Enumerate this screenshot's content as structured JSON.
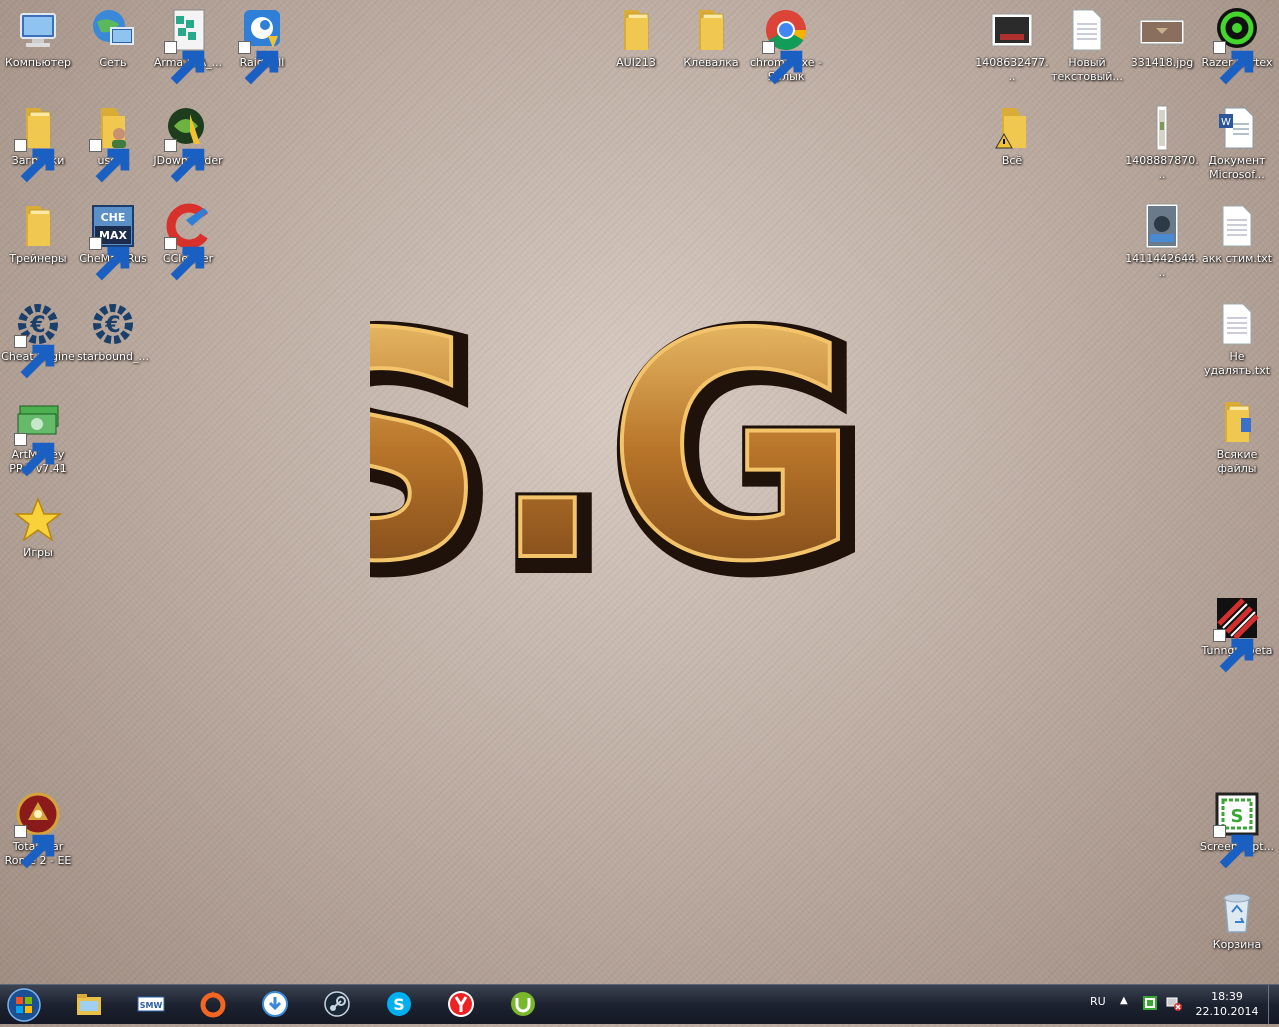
{
  "desktop": {
    "icons": [
      {
        "id": "computer",
        "label": "Компьютер",
        "icon": "computer-icon"
      },
      {
        "id": "network",
        "label": "Сеть",
        "icon": "network-icon"
      },
      {
        "id": "arma",
        "label": "Arma2OA_...",
        "icon": "arma-icon"
      },
      {
        "id": "raidcall",
        "label": "RaidCall",
        "icon": "raidcall-icon"
      },
      {
        "id": "aui",
        "label": "AUI213",
        "icon": "folder-icon"
      },
      {
        "id": "klevalka",
        "label": "Клевалка",
        "icon": "folder-icon"
      },
      {
        "id": "chrome",
        "label": "chrome.exe - Ярлык",
        "icon": "chrome-icon"
      },
      {
        "id": "img1408632",
        "label": "1408632477...",
        "icon": "image-icon"
      },
      {
        "id": "newtxt",
        "label": "Новый текстовый...",
        "icon": "text-file-icon"
      },
      {
        "id": "img331418",
        "label": "331418.jpg",
        "icon": "image-icon"
      },
      {
        "id": "razer",
        "label": "Razer Cortex",
        "icon": "razer-icon"
      },
      {
        "id": "downloads",
        "label": "Загрузки",
        "icon": "folder-icon"
      },
      {
        "id": "user1",
        "label": "user1",
        "icon": "user-folder-icon"
      },
      {
        "id": "jdownloader",
        "label": "JDownloader",
        "icon": "jdownloader-icon"
      },
      {
        "id": "vse",
        "label": "Всё",
        "icon": "folder-warning-icon"
      },
      {
        "id": "img1408887",
        "label": "1408887870...",
        "icon": "image-icon"
      },
      {
        "id": "docword",
        "label": "Документ Microsof...",
        "icon": "word-doc-icon"
      },
      {
        "id": "trainers",
        "label": "Трейнеры",
        "icon": "folder-icon"
      },
      {
        "id": "chemax",
        "label": "CheMax Rus",
        "icon": "chemax-icon"
      },
      {
        "id": "ccleaner",
        "label": "CCleaner",
        "icon": "ccleaner-icon"
      },
      {
        "id": "img1411442",
        "label": "1411442644...",
        "icon": "image-icon"
      },
      {
        "id": "akksteam",
        "label": "акк стим.txt",
        "icon": "text-file-icon"
      },
      {
        "id": "cheatengine",
        "label": "Cheat Engine",
        "icon": "cheat-engine-icon"
      },
      {
        "id": "starbound",
        "label": "starbound_...",
        "icon": "cheat-engine-icon"
      },
      {
        "id": "neudalyat",
        "label": "Не удалять.txt",
        "icon": "text-file-icon"
      },
      {
        "id": "artmoney",
        "label": "ArtMoney PRO v7.41",
        "icon": "artmoney-icon"
      },
      {
        "id": "vsyakie",
        "label": "Всякие файлы",
        "icon": "folder-icon"
      },
      {
        "id": "games",
        "label": "Игры",
        "icon": "star-icon"
      },
      {
        "id": "tunngle",
        "label": "Tunngle beta",
        "icon": "tunngle-icon"
      },
      {
        "id": "totalwar",
        "label": "Total War Rome 2 - EE",
        "icon": "totalwar-icon"
      },
      {
        "id": "screencapt",
        "label": "ScreenCapt...",
        "icon": "screencapture-icon"
      },
      {
        "id": "recycle",
        "label": "Корзина",
        "icon": "recycle-bin-icon"
      }
    ],
    "wallpaper_logo": "S.G."
  },
  "taskbar": {
    "apps": [
      "explorer-icon",
      "smw-icon",
      "origin-icon",
      "download-icon",
      "steam-icon",
      "skype-icon",
      "yandex-icon",
      "utorrent-icon"
    ],
    "tray": {
      "lang": "RU",
      "arrow": "▲",
      "time": "18:39",
      "date": "22.10.2014"
    }
  },
  "colors": {
    "taskbar": "#1d2230",
    "folder": "#e8c04a",
    "logo_gold": "#d9a23a"
  }
}
